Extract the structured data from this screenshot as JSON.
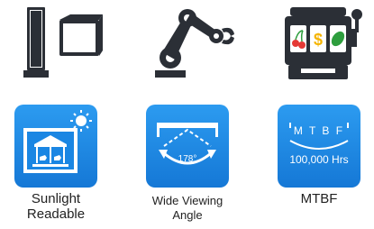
{
  "top_icons": [
    {
      "name": "kiosk-display-icon"
    },
    {
      "name": "robotic-arm-icon"
    },
    {
      "name": "slot-machine-icon",
      "symbols": [
        "cherry",
        "$",
        "leaf"
      ]
    }
  ],
  "features": [
    {
      "label": "Sunlight Readable",
      "line1": "Sunlight",
      "line2": "Readable",
      "icon": "sunlight-readable-icon"
    },
    {
      "label": "Wide Viewing Angle",
      "line1": "Wide Viewing",
      "line2": "Angle",
      "icon": "wide-viewing-angle-icon",
      "angle": "178°"
    },
    {
      "label": "MTBF",
      "line1": "MTBF",
      "icon": "mtbf-icon",
      "title": "M T B F",
      "value": "100,000 Hrs"
    }
  ],
  "colors": {
    "tile": "#1a86e3",
    "icon_dark": "#2b2f36",
    "cherry": "#e53935",
    "dollar": "#f5b400",
    "leaf": "#2e9e3e"
  }
}
